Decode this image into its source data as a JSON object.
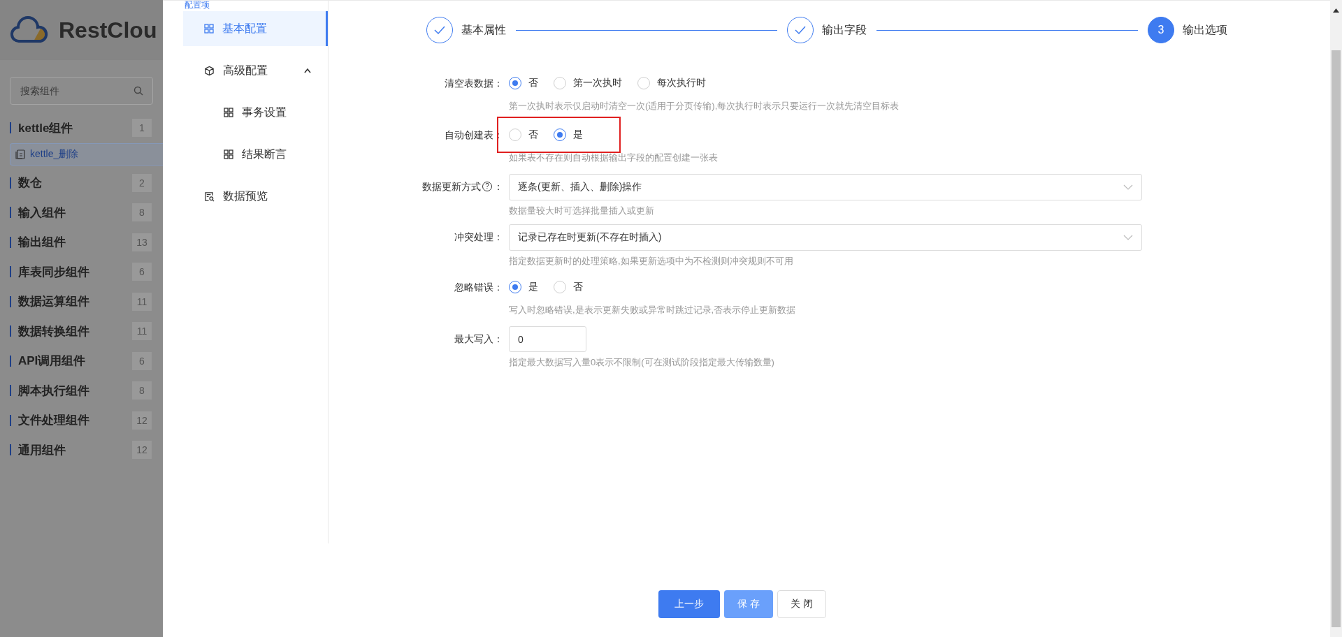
{
  "app": {
    "logo_text": "RestClou",
    "search": {
      "placeholder": "搜索组件"
    },
    "categories": [
      {
        "label": "kettle组件",
        "count": "1",
        "children": [
          {
            "label": "kettle_删除"
          }
        ]
      },
      {
        "label": "数仓",
        "count": "2"
      },
      {
        "label": "输入组件",
        "count": "8"
      },
      {
        "label": "输出组件",
        "count": "13"
      },
      {
        "label": "库表同步组件",
        "count": "6"
      },
      {
        "label": "数据运算组件",
        "count": "11"
      },
      {
        "label": "数据转换组件",
        "count": "11"
      },
      {
        "label": "API调用组件",
        "count": "6"
      },
      {
        "label": "脚本执行组件",
        "count": "8"
      },
      {
        "label": "文件处理组件",
        "count": "12"
      },
      {
        "label": "通用组件",
        "count": "12"
      }
    ]
  },
  "drawer": {
    "menu_title": "配置项",
    "menu": [
      {
        "label": "基本配置",
        "selected": true
      },
      {
        "label": "高级配置",
        "selected": false,
        "expanded": true,
        "children": [
          {
            "label": "事务设置",
            "selected": false
          },
          {
            "label": "结果断言",
            "selected": false
          }
        ]
      },
      {
        "label": "数据预览",
        "selected": false
      }
    ],
    "steps": [
      {
        "label": "基本属性",
        "done": true
      },
      {
        "label": "输出字段",
        "done": true
      },
      {
        "label": "输出选项",
        "done": false,
        "number": "3"
      }
    ],
    "form": [
      {
        "kind": "radio",
        "label": "清空表数据：",
        "options": [
          {
            "label": "否",
            "selected": true
          },
          {
            "label": "第一次执时",
            "selected": false
          },
          {
            "label": "每次执行时",
            "selected": false
          }
        ],
        "hint": "第一次执时表示仅启动时清空一次(适用于分页传输),每次执行时表示只要运行一次就先清空目标表"
      },
      {
        "kind": "radio",
        "label": "自动创建表：",
        "highlighted": true,
        "options": [
          {
            "label": "否",
            "selected": false
          },
          {
            "label": "是",
            "selected": true
          }
        ],
        "hint": "如果表不存在则自动根据输出字段的配置创建一张表"
      },
      {
        "kind": "select",
        "label": "数据更新方式",
        "help": "?",
        "label_suffix": "：",
        "value": "逐条(更新、插入、删除)操作",
        "hint": "数据量较大时可选择批量插入或更新"
      },
      {
        "kind": "select",
        "label": "冲突处理：",
        "value": "记录已存在时更新(不存在时插入)",
        "hint": "指定数据更新时的处理策略,如果更新选项中为不检测则冲突规则不可用"
      },
      {
        "kind": "radio",
        "label": "忽略错误：",
        "options": [
          {
            "label": "是",
            "selected": true
          },
          {
            "label": "否",
            "selected": false
          }
        ],
        "hint": "写入时忽略错误,是表示更新失败或异常时跳过记录,否表示停止更新数据"
      },
      {
        "kind": "input",
        "label": "最大写入：",
        "value": "0",
        "hint": "指定最大数据写入量0表示不限制(可在测试阶段指定最大传输数量)"
      }
    ],
    "buttons": [
      {
        "label": "上一步",
        "kind": "primary"
      },
      {
        "label": "保 存",
        "kind": "light"
      },
      {
        "label": "关 闭",
        "kind": "plain"
      }
    ]
  }
}
